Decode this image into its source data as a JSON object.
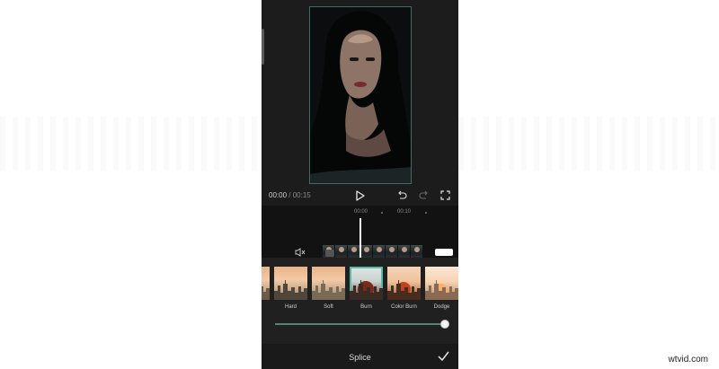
{
  "playback": {
    "current_time": "00:00",
    "separator": " / ",
    "total_time": "00:15"
  },
  "timeline": {
    "ticks": [
      "00:00",
      "00:10"
    ]
  },
  "blend_modes": {
    "items": [
      {
        "label": "Hard"
      },
      {
        "label": "Soft"
      },
      {
        "label": "Burn",
        "selected": true
      },
      {
        "label": "Color Burn"
      },
      {
        "label": "Dodge"
      }
    ],
    "opacity_value_fraction": 1.0
  },
  "bottom_bar": {
    "title": "Splice"
  },
  "watermark": {
    "text": "wtvid.com"
  },
  "colors": {
    "accent": "#5fb8a6",
    "panel_bg": "#202020",
    "app_bg": "#1c1c1c"
  },
  "icons": [
    "play-icon",
    "undo-icon",
    "redo-icon",
    "fullscreen-icon",
    "mute-icon",
    "checkmark-icon"
  ]
}
